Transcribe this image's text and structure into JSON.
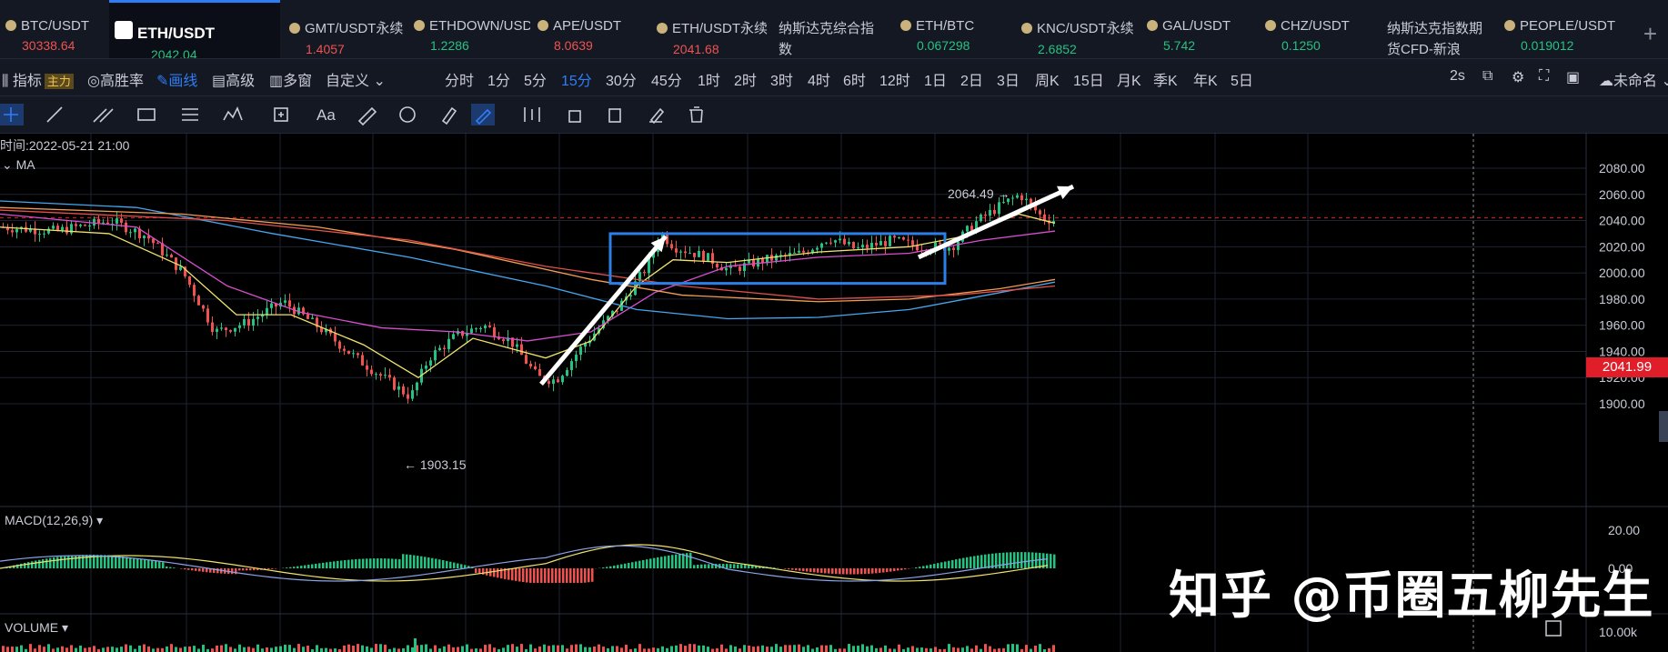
{
  "tabs": [
    {
      "name": "BTC/USDT",
      "price": "30338.64",
      "dir": "dn",
      "icon": "coin-icon"
    },
    {
      "name": "ETH/USDT",
      "price": "2042.04",
      "dir": "up",
      "icon": "eth-logo-icon",
      "active": true
    },
    {
      "name": "GMT/USDT永续",
      "price": "1.4057",
      "dir": "dn",
      "icon": "coin-icon"
    },
    {
      "name": "ETHDOWN/USDT",
      "price": "1.2286",
      "dir": "up",
      "icon": "coin-icon"
    },
    {
      "name": "APE/USDT",
      "price": "8.0639",
      "dir": "dn",
      "icon": "coin-icon"
    },
    {
      "name": "ETH/USDT永续",
      "price": "2041.68",
      "dir": "dn",
      "icon": "coin-icon"
    },
    {
      "name": "纳斯达克综合指",
      "price": "数",
      "dir": "none",
      "icon": ""
    },
    {
      "name": "ETH/BTC",
      "price": "0.067298",
      "dir": "up",
      "icon": "coin-icon"
    },
    {
      "name": "KNC/USDT永续",
      "price": "2.6852",
      "dir": "up",
      "icon": "coin-icon"
    },
    {
      "name": "GAL/USDT",
      "price": "5.742",
      "dir": "up",
      "icon": "coin-icon"
    },
    {
      "name": "CHZ/USDT",
      "price": "0.1250",
      "dir": "up",
      "icon": "coin-icon"
    },
    {
      "name": "纳斯达克指数期",
      "price": "货CFD-新浪",
      "dir": "none",
      "icon": ""
    },
    {
      "name": "PEOPLE/USDT",
      "price": "0.019012",
      "dir": "up",
      "icon": "coin-icon"
    }
  ],
  "toolbar": {
    "indicators": "指标",
    "main_badge": "主力",
    "win_rate": "高胜率",
    "draw": "画线",
    "advanced": "高级",
    "multi_window": "多窗",
    "custom": "自定义",
    "intervals": [
      "分时",
      "1分",
      "5分",
      "15分",
      "30分",
      "45分",
      "1时",
      "2时",
      "3时",
      "4时",
      "6时",
      "12时",
      "1日",
      "2日",
      "3日",
      "周K",
      "15日",
      "月K",
      "季K",
      "年K",
      "5日"
    ],
    "selected_interval": "15分",
    "refresh": "2s",
    "unnamed": "未命名"
  },
  "drawing_tools": [
    "crosshair-icon",
    "line-icon",
    "parallel-lines-icon",
    "rectangle-icon",
    "fib-icon",
    "pattern-icon",
    "measure-icon",
    "text-icon",
    "eraser-icon",
    "magnet-icon",
    "ruler-icon",
    "pen-icon",
    "candles-icon",
    "lock-icon",
    "copy-icon",
    "edit-icon",
    "trash-icon"
  ],
  "chart_labels": {
    "time": "时间:2022-05-21 21:00",
    "ma": "MA",
    "macd": "MACD(12,26,9)",
    "volume": "VOLUME",
    "high_label": "2064.49",
    "low_label": "1903.15",
    "current_price": "2041.99",
    "watermark": "知乎 @币圈五柳先生"
  },
  "chart_data": {
    "type": "candlestick",
    "price_axis": [
      "2080.00",
      "2060.00",
      "2040.00",
      "2020.00",
      "2000.00",
      "1980.00",
      "1960.00",
      "1940.00",
      "1920.00",
      "1900.00"
    ],
    "macd_axis": [
      "20.00",
      "0.00"
    ],
    "volume_axis": [
      "10.00k"
    ],
    "ylim": [
      1890,
      2090
    ],
    "high": 2064.49,
    "low": 1903.15,
    "last": 2041.99
  },
  "colors": {
    "up": "#26c281",
    "down": "#ef5350",
    "accent": "#2f7df6",
    "box": "#2b7fe8"
  }
}
